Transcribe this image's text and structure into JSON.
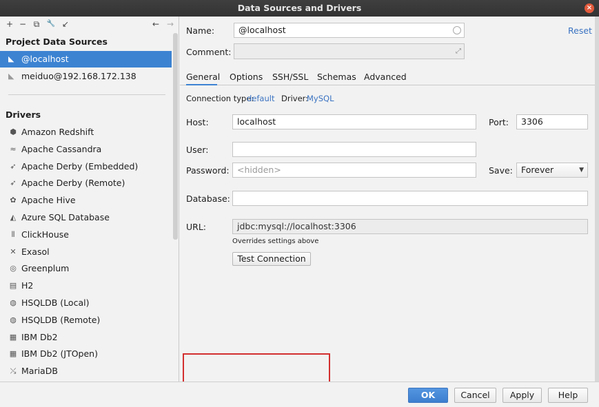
{
  "window": {
    "title": "Data Sources and Drivers",
    "close_glyph": "×"
  },
  "left_toolbar": {
    "add": "+",
    "remove": "−",
    "duplicate": "⧉",
    "settings": "🔧",
    "export": "↙",
    "back": "←",
    "forward": "→"
  },
  "project": {
    "title": "Project Data Sources",
    "items": [
      {
        "label": "@localhost",
        "icon": "mysql-dolphin-icon",
        "selected": true
      },
      {
        "label": "meiduo@192.168.172.138",
        "icon": "mysql-dolphin-icon",
        "selected": false
      }
    ]
  },
  "drivers": {
    "title": "Drivers",
    "items": [
      {
        "label": "Amazon Redshift",
        "icon": "redshift-icon",
        "glyph": "⬢"
      },
      {
        "label": "Apache Cassandra",
        "icon": "cassandra-icon",
        "glyph": "≈"
      },
      {
        "label": "Apache Derby (Embedded)",
        "icon": "derby-icon",
        "glyph": "➶"
      },
      {
        "label": "Apache Derby (Remote)",
        "icon": "derby-icon",
        "glyph": "➶"
      },
      {
        "label": "Apache Hive",
        "icon": "hive-icon",
        "glyph": "✿"
      },
      {
        "label": "Azure SQL Database",
        "icon": "azure-icon",
        "glyph": "◭"
      },
      {
        "label": "ClickHouse",
        "icon": "clickhouse-icon",
        "glyph": "⦀"
      },
      {
        "label": "Exasol",
        "icon": "exasol-icon",
        "glyph": "✕"
      },
      {
        "label": "Greenplum",
        "icon": "greenplum-icon",
        "glyph": "◎"
      },
      {
        "label": "H2",
        "icon": "h2-icon",
        "glyph": "▤"
      },
      {
        "label": "HSQLDB (Local)",
        "icon": "hsqldb-icon",
        "glyph": "◍"
      },
      {
        "label": "HSQLDB (Remote)",
        "icon": "hsqldb-icon",
        "glyph": "◍"
      },
      {
        "label": "IBM Db2",
        "icon": "ibm-icon",
        "glyph": "▦"
      },
      {
        "label": "IBM Db2 (JTOpen)",
        "icon": "ibm-icon",
        "glyph": "▦"
      },
      {
        "label": "MariaDB",
        "icon": "mariadb-icon",
        "glyph": "⤯"
      }
    ]
  },
  "form": {
    "name_label": "Name:",
    "name_value": "@localhost",
    "reset": "Reset",
    "comment_label": "Comment:",
    "comment_value": "",
    "tabs": [
      "General",
      "Options",
      "SSH/SSL",
      "Schemas",
      "Advanced"
    ],
    "connection_type_label": "Connection type:",
    "connection_type_value": "default",
    "driver_label": "Driver:",
    "driver_value": "MySQL",
    "host_label": "Host:",
    "host_value": "localhost",
    "port_label": "Port:",
    "port_value": "3306",
    "user_label": "User:",
    "user_value": "",
    "password_label": "Password:",
    "password_placeholder": "<hidden>",
    "save_label": "Save:",
    "save_value": "Forever",
    "database_label": "Database:",
    "database_value": "",
    "url_label": "URL:",
    "url_value": "jdbc:mysql://localhost:3306",
    "url_hint": "Overrides settings above",
    "test_connection": "Test Connection"
  },
  "footer": {
    "ok": "OK",
    "cancel": "Cancel",
    "apply": "Apply",
    "help": "Help"
  },
  "colors": {
    "accent": "#3c83d2",
    "link": "#3b73c2",
    "highlight_box": "#d32f2f"
  }
}
